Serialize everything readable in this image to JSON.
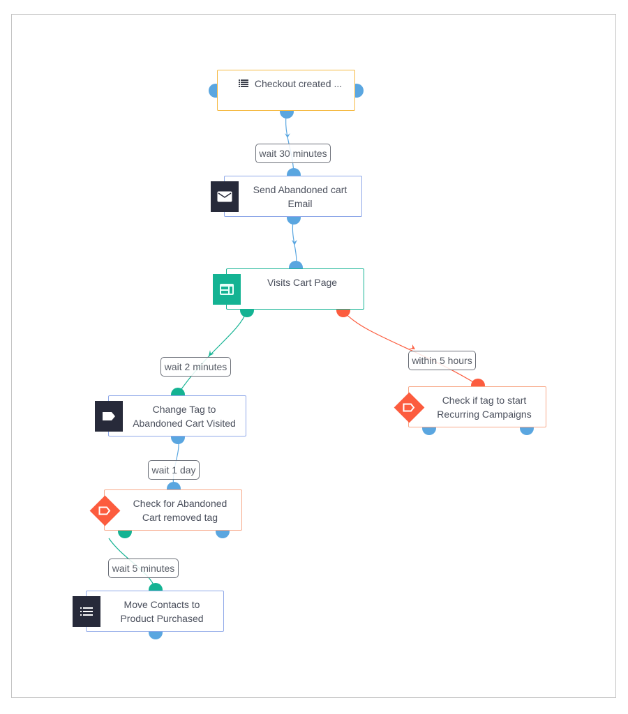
{
  "colors": {
    "port_default": "#5aa6e0",
    "port_yes": "#14b393",
    "port_no": "#fc5c3e",
    "trigger_border": "#f5b942",
    "action_border": "#8fa8e8",
    "condition_border": "#f7a98a",
    "goal_border": "#14b393",
    "icon_dark": "#272a3a"
  },
  "nodes": [
    {
      "id": "checkout",
      "text": "Checkout created ...",
      "icon": "list-icon",
      "type": "trigger"
    },
    {
      "id": "email",
      "text": "Send Abandoned cart Email",
      "icon": "envelope-icon",
      "type": "action"
    },
    {
      "id": "visits",
      "text": "Visits Cart Page",
      "icon": "webpage-icon",
      "type": "goal"
    },
    {
      "id": "change_tag",
      "text": "Change Tag to Abandoned Cart Visited",
      "icon": "tag-icon",
      "type": "action"
    },
    {
      "id": "check_removed",
      "text": "Check for Abandoned Cart removed tag",
      "icon": "tag-condition-icon",
      "type": "condition"
    },
    {
      "id": "move_contacts",
      "text": "Move Contacts to Product Purchased",
      "icon": "list-icon",
      "type": "action"
    },
    {
      "id": "check_recurring",
      "text": "Check if tag to start Recurring Campaigns",
      "icon": "tag-condition-icon",
      "type": "condition"
    }
  ],
  "edge_labels": {
    "wait30": "wait 30 minutes",
    "wait2": "wait 2 minutes",
    "within5": "within 5 hours",
    "wait1day": "wait 1 day",
    "wait5": "wait 5 minutes"
  }
}
